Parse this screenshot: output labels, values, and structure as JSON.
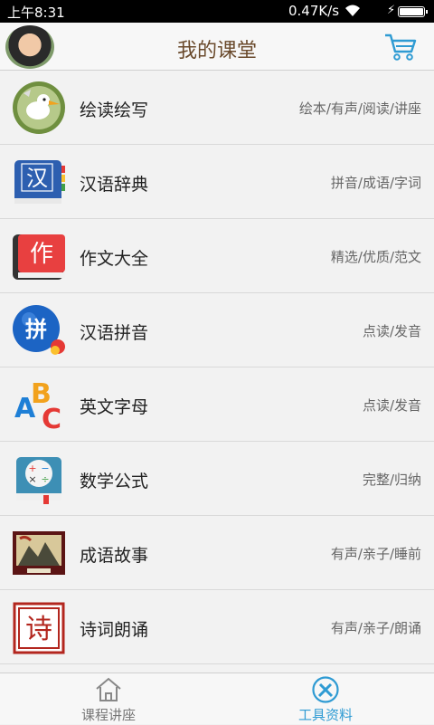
{
  "status_bar": {
    "time": "上午8:31",
    "network_speed": "0.47K/s"
  },
  "header": {
    "title": "我的课堂"
  },
  "list": [
    {
      "title": "绘读绘写",
      "tags": "绘本/有声/阅读/讲座",
      "icon": "cartoon-bird-icon"
    },
    {
      "title": "汉语辞典",
      "tags": "拼音/成语/字词",
      "icon": "dictionary-book-icon",
      "glyph": "汉"
    },
    {
      "title": "作文大全",
      "tags": "精选/优质/范文",
      "icon": "composition-book-icon",
      "glyph": "作"
    },
    {
      "title": "汉语拼音",
      "tags": "点读/发音",
      "icon": "pinyin-ball-icon",
      "glyph": "拼"
    },
    {
      "title": "英文字母",
      "tags": "点读/发音",
      "icon": "abc-letters-icon",
      "glyph": "ABC"
    },
    {
      "title": "数学公式",
      "tags": "完整/归纳",
      "icon": "math-book-icon"
    },
    {
      "title": "成语故事",
      "tags": "有声/亲子/睡前",
      "icon": "idiom-painting-icon"
    },
    {
      "title": "诗词朗诵",
      "tags": "有声/亲子/朗诵",
      "icon": "poetry-seal-icon",
      "glyph": "诗"
    }
  ],
  "bottom_nav": {
    "tabs": [
      {
        "label": "课程讲座",
        "icon": "house-icon",
        "active": false
      },
      {
        "label": "工具资料",
        "icon": "pencil-ruler-icon",
        "active": true
      }
    ]
  },
  "colors": {
    "accent": "#2f9bd3",
    "title": "#6a4a2c"
  }
}
